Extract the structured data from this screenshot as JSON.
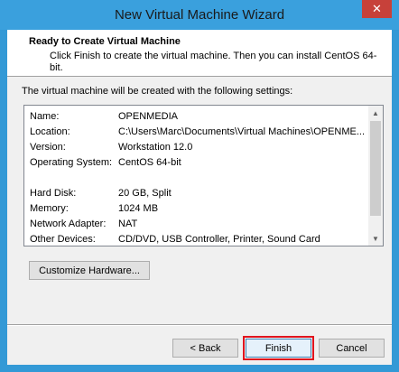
{
  "window": {
    "title": "New Virtual Machine Wizard",
    "close_glyph": "✕",
    "accent_color": "#3aa0dd",
    "close_color": "#c7413a"
  },
  "header": {
    "title": "Ready to Create Virtual Machine",
    "subtitle": "Click Finish to create the virtual machine. Then you can install CentOS 64-bit."
  },
  "settings": {
    "label": "The virtual machine will be created with the following settings:",
    "rows": [
      {
        "key": "Name:",
        "value": "OPENMEDIA"
      },
      {
        "key": "Location:",
        "value": "C:\\Users\\Marc\\Documents\\Virtual Machines\\OPENME..."
      },
      {
        "key": "Version:",
        "value": "Workstation 12.0"
      },
      {
        "key": "Operating System:",
        "value": "CentOS 64-bit"
      },
      {
        "key": "",
        "value": ""
      },
      {
        "key": "Hard Disk:",
        "value": "20 GB, Split"
      },
      {
        "key": "Memory:",
        "value": "1024 MB"
      },
      {
        "key": "Network Adapter:",
        "value": "NAT"
      },
      {
        "key": "Other Devices:",
        "value": "CD/DVD, USB Controller, Printer, Sound Card"
      }
    ],
    "scroll_up_glyph": "▲",
    "scroll_down_glyph": "▼"
  },
  "buttons": {
    "customize": "Customize Hardware...",
    "back": "< Back",
    "finish": "Finish",
    "cancel": "Cancel"
  },
  "highlight_color": "#e0141e"
}
